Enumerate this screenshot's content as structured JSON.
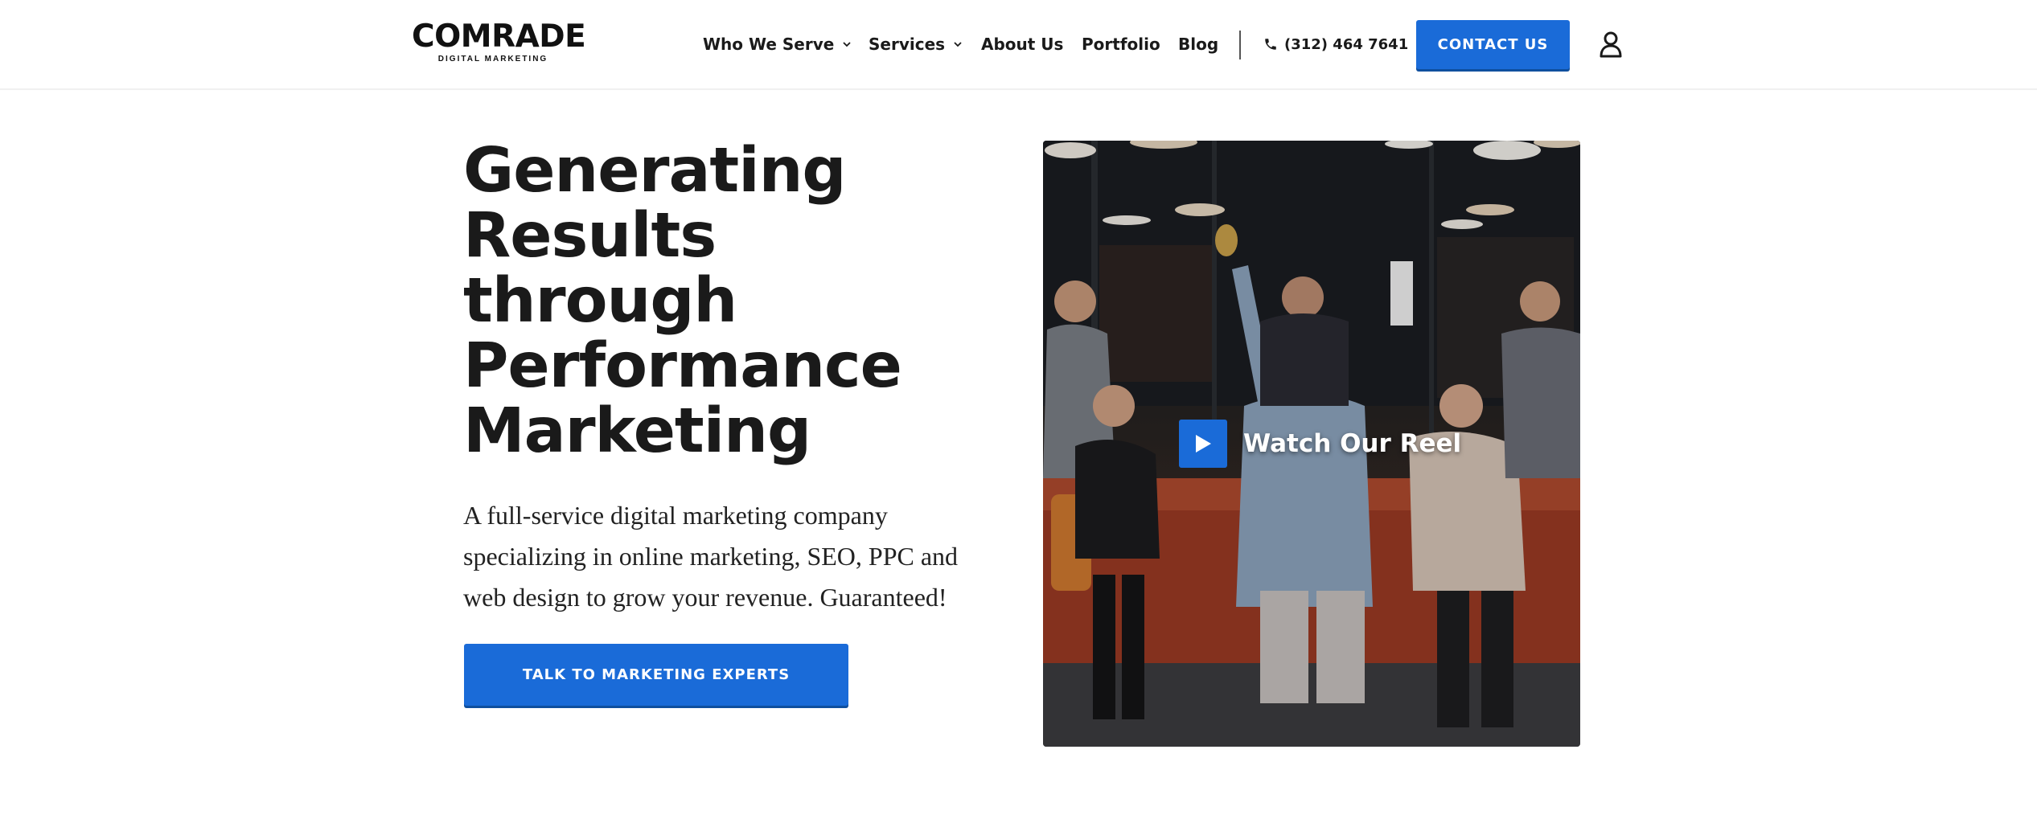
{
  "header": {
    "logo": {
      "main": "COMRADE",
      "sub": "DIGITAL MARKETING"
    },
    "nav": [
      {
        "label": "Who We Serve",
        "has_dropdown": true
      },
      {
        "label": "Services",
        "has_dropdown": true
      },
      {
        "label": "About Us",
        "has_dropdown": false
      },
      {
        "label": "Portfolio",
        "has_dropdown": false
      },
      {
        "label": "Blog",
        "has_dropdown": false
      }
    ],
    "phone": "(312) 464 7641",
    "contact_label": "CONTACT US",
    "icons": {
      "phone": "phone-icon",
      "account": "user-icon",
      "dropdown": "chevron-down-icon"
    }
  },
  "hero": {
    "title_lines": [
      "Generating",
      "Results",
      "through",
      "Performance",
      "Marketing"
    ],
    "description_lines": [
      "A full-service digital marketing company",
      "specializing in online marketing, SEO, PPC and",
      "web design to grow your revenue. Guaranteed!"
    ],
    "cta_label": "TALK TO MARKETING EXPERTS"
  },
  "video": {
    "label": "Watch Our Reel",
    "icon": "play-icon"
  },
  "colors": {
    "accent": "#1a6bd8",
    "accent_shadow": "#0f4f9e",
    "text": "#1a1a1a",
    "background": "#ffffff"
  }
}
